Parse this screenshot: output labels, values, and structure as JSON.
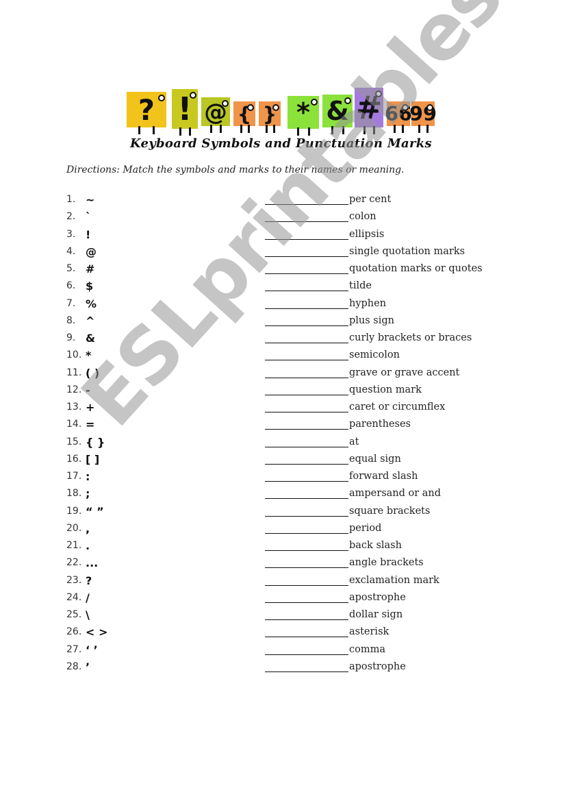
{
  "banner": {
    "characters": [
      {
        "glyph": "?",
        "color": "#f2c31b"
      },
      {
        "glyph": "!",
        "color": "#c8c81e"
      },
      {
        "glyph": "@",
        "color": "#b9c623"
      },
      {
        "glyph": "{",
        "color": "#f0944a"
      },
      {
        "glyph": "}",
        "color": "#f0944a"
      },
      {
        "glyph": "*",
        "color": "#8be23b"
      },
      {
        "glyph": "&",
        "color": "#8be23b"
      },
      {
        "glyph": "#",
        "color": "#a57ae0"
      },
      {
        "glyph": "66",
        "color": "#f0944a"
      },
      {
        "glyph": "99",
        "color": "#f0944a"
      }
    ]
  },
  "title": "Keyboard Symbols and Punctuation Marks",
  "directions": "Directions: Match the symbols and marks to their names or meaning.",
  "items": [
    {
      "num": "1.",
      "symbol": "~",
      "name": "per cent"
    },
    {
      "num": "2.",
      "symbol": "`",
      "name": "colon"
    },
    {
      "num": "3.",
      "symbol": "!",
      "name": "ellipsis"
    },
    {
      "num": "4.",
      "symbol": "@",
      "name": "single quotation marks"
    },
    {
      "num": "5.",
      "symbol": "#",
      "name": "quotation marks or quotes"
    },
    {
      "num": "6.",
      "symbol": "$",
      "name": "tilde"
    },
    {
      "num": "7.",
      "symbol": "%",
      "name": "hyphen"
    },
    {
      "num": "8.",
      "symbol": "^",
      "name": "plus sign"
    },
    {
      "num": "9.",
      "symbol": "&",
      "name": "curly brackets or braces"
    },
    {
      "num": "10.",
      "symbol": "*",
      "name": "semicolon"
    },
    {
      "num": "11.",
      "symbol": "( )",
      "name": "grave or grave accent"
    },
    {
      "num": "12.",
      "symbol": "-",
      "name": "question mark"
    },
    {
      "num": "13.",
      "symbol": "+",
      "name": "caret or circumflex"
    },
    {
      "num": "14.",
      "symbol": "=",
      "name": "parentheses"
    },
    {
      "num": "15.",
      "symbol": "{ }",
      "name": "at"
    },
    {
      "num": "16.",
      "symbol": "[ ]",
      "name": "equal sign"
    },
    {
      "num": "17.",
      "symbol": ":",
      "name": "forward slash"
    },
    {
      "num": "18.",
      "symbol": ";",
      "name": "ampersand or and"
    },
    {
      "num": "19.",
      "symbol": "“  ”",
      "name": "square brackets"
    },
    {
      "num": "20.",
      "symbol": ",",
      "name": "period"
    },
    {
      "num": "21.",
      "symbol": ".",
      "name": "back slash"
    },
    {
      "num": "22.",
      "symbol": "...",
      "name": "angle brackets"
    },
    {
      "num": "23.",
      "symbol": "?",
      "name": "exclamation mark"
    },
    {
      "num": "24.",
      "symbol": "/",
      "name": "apostrophe"
    },
    {
      "num": "25.",
      "symbol": "\\",
      "name": "dollar sign"
    },
    {
      "num": "26.",
      "symbol": "< >",
      "name": "asterisk"
    },
    {
      "num": "27.",
      "symbol": "‘ ’",
      "name": "comma"
    },
    {
      "num": "28.",
      "symbol": "’",
      "name": "apostrophe"
    }
  ],
  "watermark": "ESLprintables.com"
}
